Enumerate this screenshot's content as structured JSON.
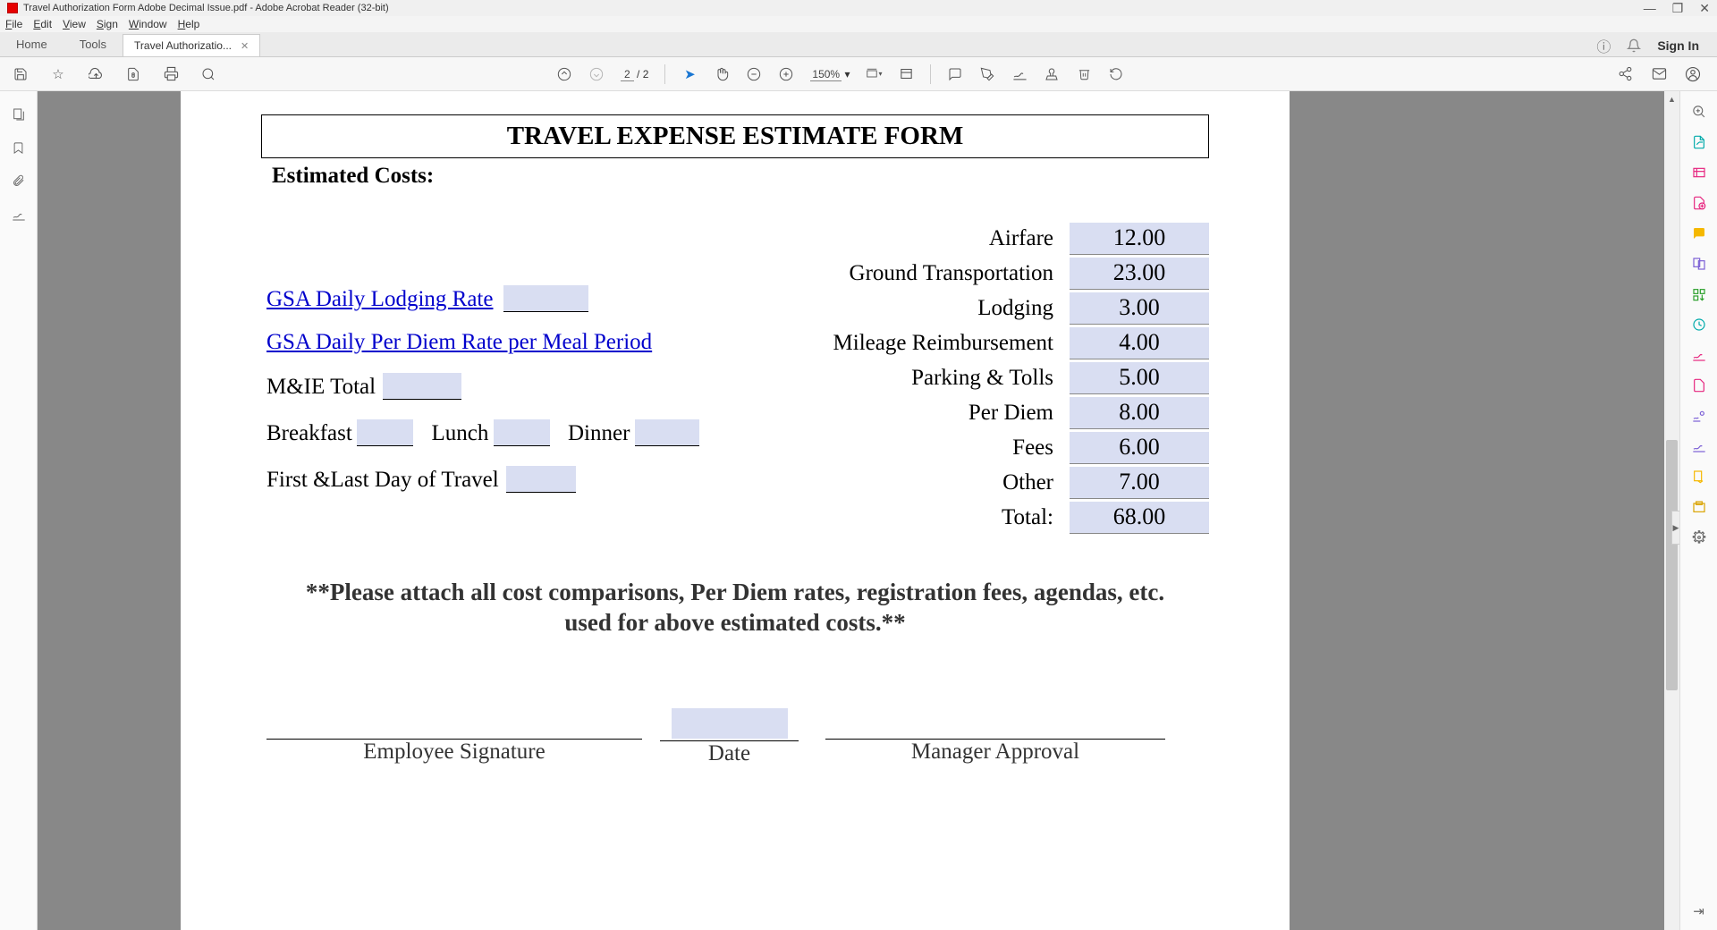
{
  "window": {
    "title": "Travel Authorization Form Adobe Decimal Issue.pdf - Adobe Acrobat Reader (32-bit)"
  },
  "menu": {
    "file": "File",
    "edit": "Edit",
    "view": "View",
    "sign": "Sign",
    "window": "Window",
    "help": "Help"
  },
  "tabs": {
    "home": "Home",
    "tools": "Tools",
    "doc": "Travel Authorizatio...",
    "signin": "Sign In"
  },
  "toolbar": {
    "page_current": "2",
    "page_sep": "/",
    "page_total": "2",
    "zoom": "150%"
  },
  "form": {
    "title": "TRAVEL EXPENSE ESTIMATE FORM",
    "estimated_costs": "Estimated Costs:",
    "links": {
      "lodging": "GSA Daily Lodging Rate",
      "perdiem": "GSA Daily Per Diem Rate per Meal Period"
    },
    "labels": {
      "mie_total": "M&IE Total",
      "breakfast": "Breakfast",
      "lunch": "Lunch",
      "dinner": "Dinner",
      "first_last": "First &Last Day of Travel",
      "airfare": "Airfare",
      "ground": "Ground Transportation",
      "lodging_r": "Lodging",
      "mileage": "Mileage Reimbursement",
      "parking": "Parking & Tolls",
      "perdiem_r": "Per Diem",
      "fees": "Fees",
      "other": "Other",
      "total": "Total:"
    },
    "values": {
      "airfare": "12.00",
      "ground": "23.00",
      "lodging": "3.00",
      "mileage": "4.00",
      "parking": "5.00",
      "perdiem": "8.00",
      "fees": "6.00",
      "other": "7.00",
      "total": "68.00"
    },
    "attach_note": "**Please attach all cost comparisons, Per Diem rates, registration fees, agendas, etc.  used for above estimated costs.**",
    "sig": {
      "employee": "Employee Signature",
      "date": "Date",
      "manager": "Manager Approval"
    }
  }
}
